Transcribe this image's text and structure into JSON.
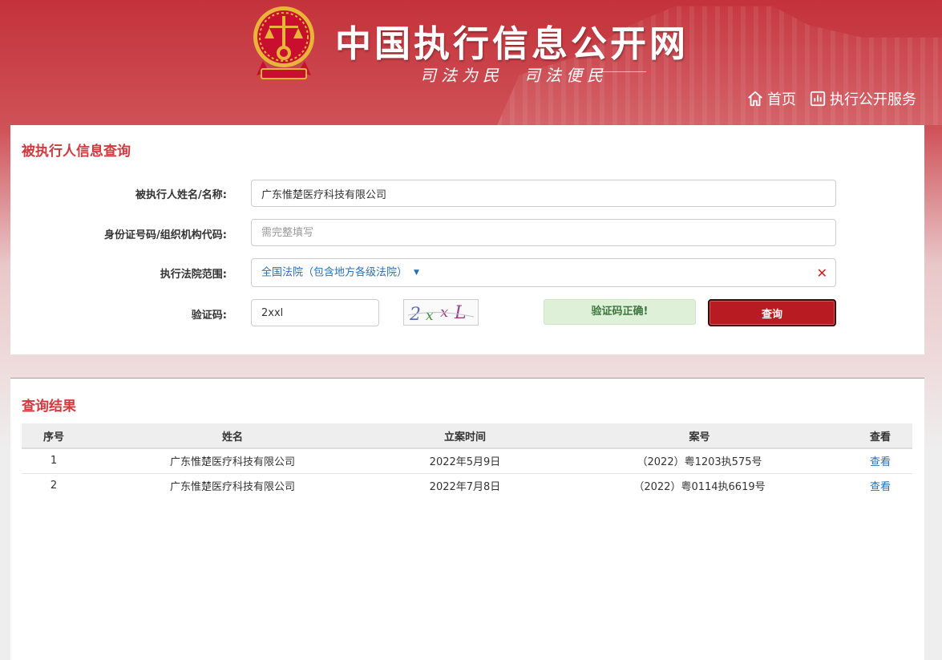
{
  "header": {
    "site_title": "中国执行信息公开网",
    "slogan": "司法为民　司法便民",
    "nav": [
      {
        "label": "首页",
        "icon": "home-icon"
      },
      {
        "label": "执行公开服务",
        "icon": "chart-icon"
      }
    ],
    "colors": {
      "header_red": "#c4323a",
      "emblem_gold": "#e8b53a",
      "emblem_red": "#c8102e"
    }
  },
  "search": {
    "title": "被执行人信息查询",
    "name_label": "被执行人姓名/名称:",
    "name_value": "广东惟楚医疗科技有限公司",
    "id_label": "身份证号码/组织机构代码:",
    "id_placeholder": "需完整填写",
    "court_label": "执行法院范围:",
    "court_value": "全国法院（包含地方各级法院）",
    "captcha_label": "验证码:",
    "captcha_value": "2xxl",
    "captcha_image_text": "2xxL",
    "captcha_status": "验证码正确!",
    "search_button": "查询",
    "accent_color": "#b81c22"
  },
  "results": {
    "title": "查询结果",
    "columns": [
      "序号",
      "姓名",
      "立案时间",
      "案号",
      "查看"
    ],
    "rows": [
      {
        "index": "1",
        "name": "广东惟楚医疗科技有限公司",
        "date": "2022年5月9日",
        "case_no": "（2022）粤1203执575号",
        "view": "查看"
      },
      {
        "index": "2",
        "name": "广东惟楚医疗科技有限公司",
        "date": "2022年7月8日",
        "case_no": "（2022）粤0114执6619号",
        "view": "查看"
      }
    ]
  }
}
